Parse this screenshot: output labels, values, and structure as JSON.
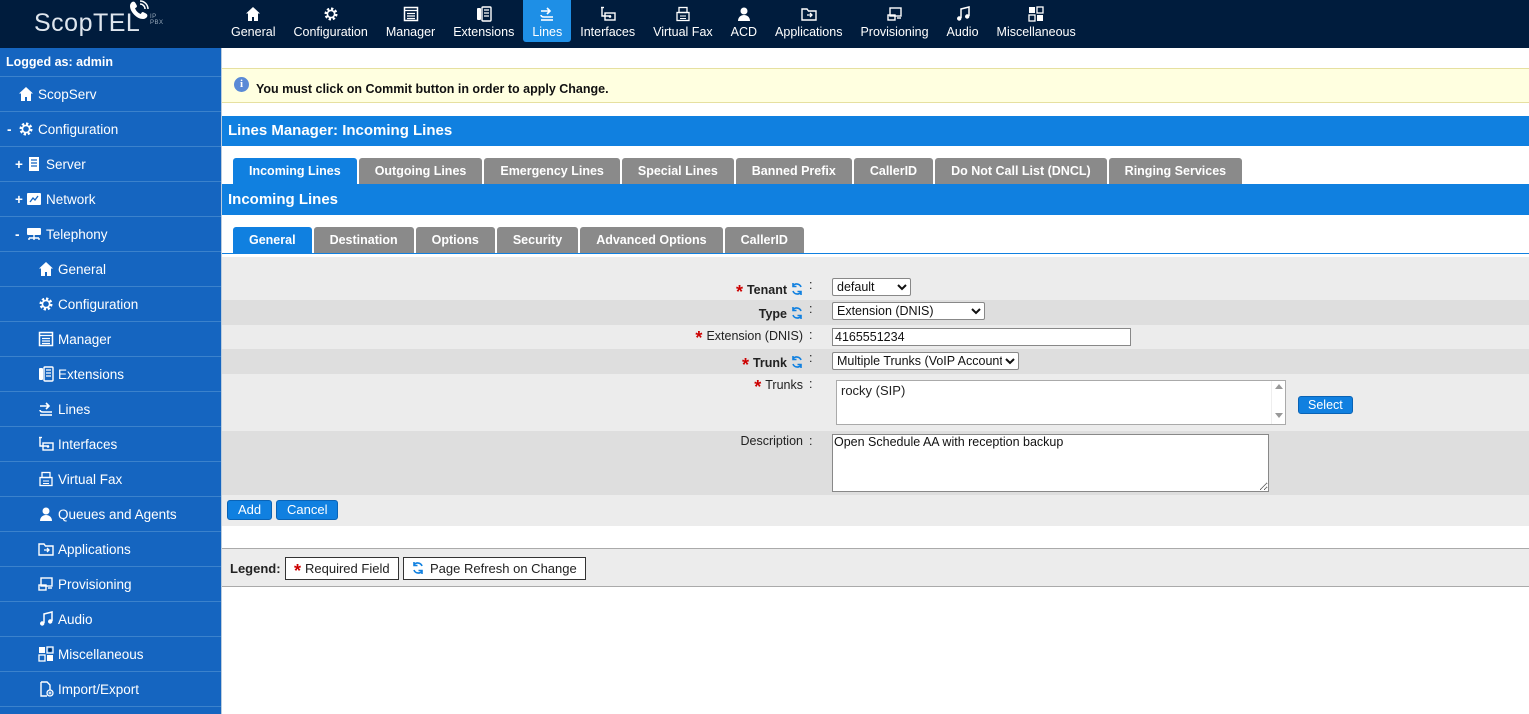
{
  "app": {
    "logo": "ScopTEL",
    "logo_sub": "IP PBX"
  },
  "topnav": [
    {
      "label": "General",
      "icon": "home-icon"
    },
    {
      "label": "Configuration",
      "icon": "gear-icon"
    },
    {
      "label": "Manager",
      "icon": "window-icon"
    },
    {
      "label": "Extensions",
      "icon": "phone-icon"
    },
    {
      "label": "Lines",
      "icon": "lines-icon",
      "active": true
    },
    {
      "label": "Interfaces",
      "icon": "interfaces-icon"
    },
    {
      "label": "Virtual Fax",
      "icon": "fax-icon"
    },
    {
      "label": "ACD",
      "icon": "person-icon"
    },
    {
      "label": "Applications",
      "icon": "applications-icon"
    },
    {
      "label": "Provisioning",
      "icon": "provisioning-icon"
    },
    {
      "label": "Audio",
      "icon": "music-icon"
    },
    {
      "label": "Miscellaneous",
      "icon": "misc-icon"
    }
  ],
  "sidebar": {
    "login": "Logged as: admin",
    "items": [
      {
        "label": "ScopServ",
        "toggle": "",
        "icon": "home-icon",
        "indent": 0
      },
      {
        "label": "Configuration",
        "toggle": "-",
        "icon": "gear-icon",
        "indent": 0
      },
      {
        "label": "Server",
        "toggle": "+",
        "icon": "server-icon",
        "indent": 1
      },
      {
        "label": "Network",
        "toggle": "+",
        "icon": "network-icon",
        "indent": 1
      },
      {
        "label": "Telephony",
        "toggle": "-",
        "icon": "telephony-icon",
        "indent": 1
      },
      {
        "label": "General",
        "toggle": "",
        "icon": "home-icon",
        "indent": 2
      },
      {
        "label": "Configuration",
        "toggle": "",
        "icon": "gear-icon",
        "indent": 2
      },
      {
        "label": "Manager",
        "toggle": "",
        "icon": "window-icon",
        "indent": 2
      },
      {
        "label": "Extensions",
        "toggle": "",
        "icon": "phone-icon",
        "indent": 2
      },
      {
        "label": "Lines",
        "toggle": "",
        "icon": "lines-icon",
        "indent": 2
      },
      {
        "label": "Interfaces",
        "toggle": "",
        "icon": "interfaces-icon",
        "indent": 2
      },
      {
        "label": "Virtual Fax",
        "toggle": "",
        "icon": "fax-icon",
        "indent": 2
      },
      {
        "label": "Queues and Agents",
        "toggle": "",
        "icon": "person-icon",
        "indent": 2
      },
      {
        "label": "Applications",
        "toggle": "",
        "icon": "applications-icon",
        "indent": 2
      },
      {
        "label": "Provisioning",
        "toggle": "",
        "icon": "provisioning-icon",
        "indent": 2
      },
      {
        "label": "Audio",
        "toggle": "",
        "icon": "music-icon",
        "indent": 2
      },
      {
        "label": "Miscellaneous",
        "toggle": "",
        "icon": "misc-icon",
        "indent": 2
      },
      {
        "label": "Import/Export",
        "toggle": "",
        "icon": "import-export-icon",
        "indent": 2
      }
    ]
  },
  "notice": "You must click on Commit button in order to apply Change.",
  "header": {
    "title": "Lines Manager:  Incoming Lines"
  },
  "main_tabs": [
    {
      "label": "Incoming Lines",
      "active": true
    },
    {
      "label": "Outgoing Lines"
    },
    {
      "label": "Emergency Lines"
    },
    {
      "label": "Special Lines"
    },
    {
      "label": "Banned Prefix"
    },
    {
      "label": "CallerID"
    },
    {
      "label": "Do Not Call List (DNCL)"
    },
    {
      "label": "Ringing Services"
    }
  ],
  "section": {
    "title": "Incoming Lines"
  },
  "sub_tabs": [
    {
      "label": "General",
      "active": true
    },
    {
      "label": "Destination"
    },
    {
      "label": "Options"
    },
    {
      "label": "Security"
    },
    {
      "label": "Advanced Options"
    },
    {
      "label": "CallerID"
    }
  ],
  "form": {
    "tenant": {
      "label": "Tenant",
      "value": "default"
    },
    "type": {
      "label": "Type",
      "value": "Extension (DNIS)"
    },
    "extension": {
      "label": "Extension (DNIS)",
      "value": "4165551234"
    },
    "trunk": {
      "label": "Trunk",
      "value": "Multiple Trunks (VoIP Account)"
    },
    "trunks": {
      "label": "Trunks",
      "items": [
        "rocky (SIP)"
      ],
      "select_label": "Select"
    },
    "description": {
      "label": "Description",
      "value": "Open Schedule AA with reception backup"
    },
    "colon": ":",
    "required_mark": "*"
  },
  "actions": {
    "add": "Add",
    "cancel": "Cancel"
  },
  "legend": {
    "label": "Legend:",
    "required": "Required Field",
    "refresh": "Page Refresh on Change"
  },
  "colors": {
    "topbar": "#001c3d",
    "accent": "#1080e0",
    "sidebar": "#1565c0",
    "tab_inactive": "#8a8a8a",
    "required": "#cc0000"
  }
}
